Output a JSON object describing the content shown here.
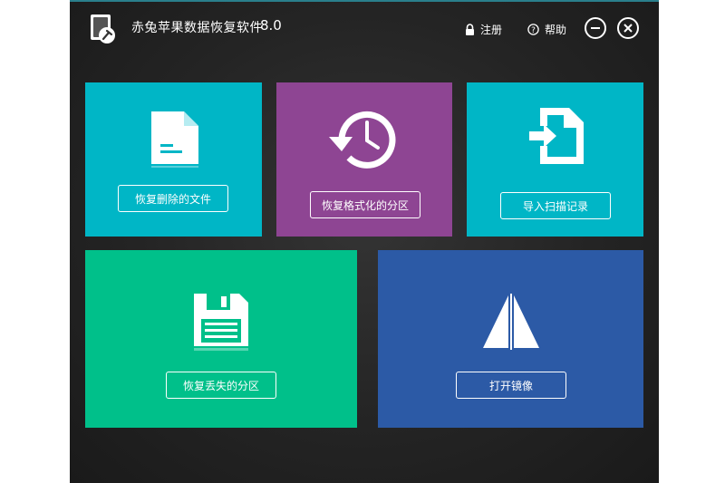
{
  "app": {
    "title": "赤兔苹果数据恢复软件",
    "version": "8.0",
    "register_label": "注册",
    "help_label": "帮助"
  },
  "tiles": {
    "deleted_files": {
      "button": "恢复删除的文件",
      "color": "#00b6c6",
      "icon": "document-icon"
    },
    "formatted_partition": {
      "button": "恢复格式化的分区",
      "color": "#8e4593",
      "icon": "history-clock-icon"
    },
    "import_scan": {
      "button": "导入扫描记录",
      "color": "#00b6c6",
      "icon": "import-file-icon"
    },
    "lost_partition": {
      "button": "恢复丢失的分区",
      "color": "#00c08a",
      "icon": "floppy-disk-icon"
    },
    "open_image": {
      "button": "打开镜像",
      "color": "#2c5aa6",
      "icon": "sail-icon"
    }
  }
}
